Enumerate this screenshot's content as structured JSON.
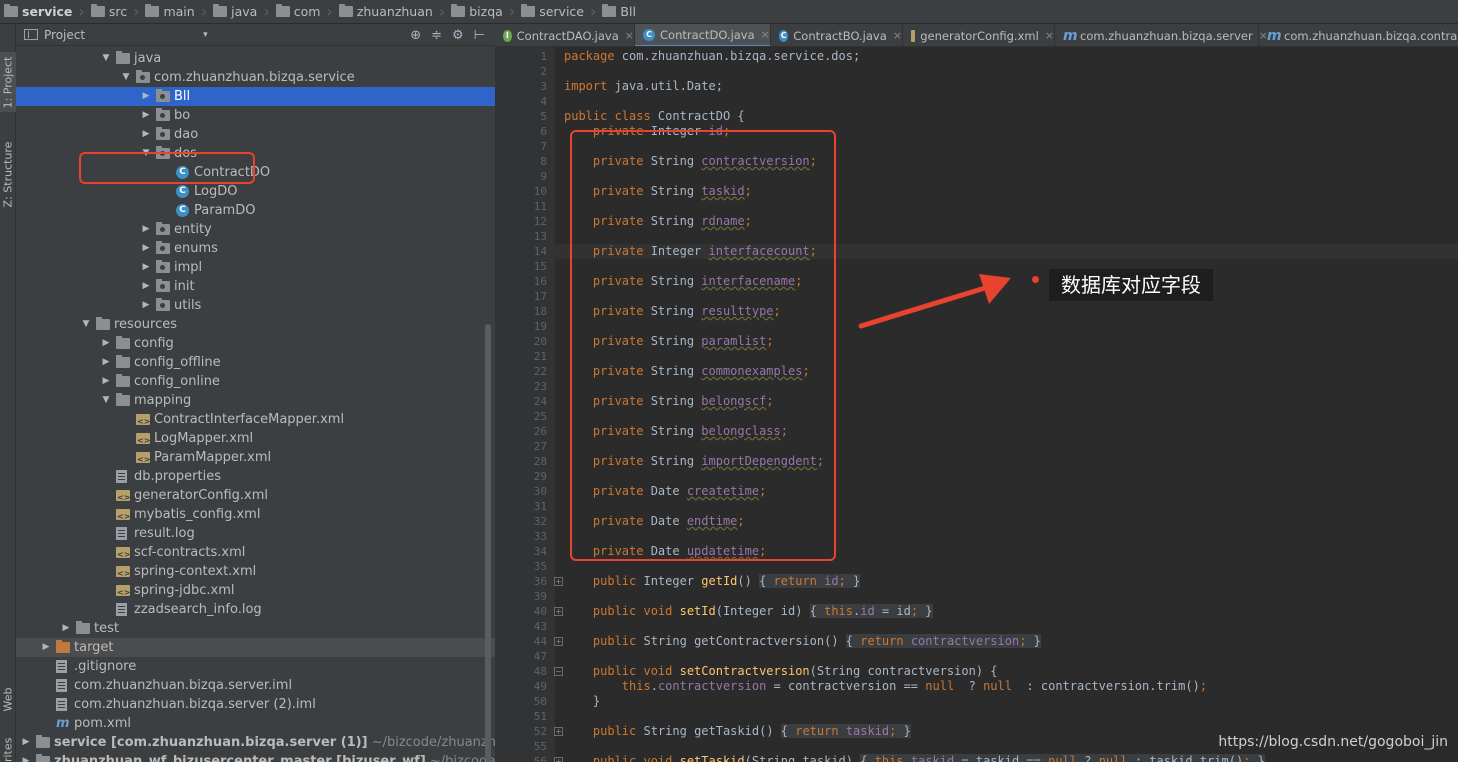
{
  "breadcrumb": [
    "service",
    "src",
    "main",
    "java",
    "com",
    "zhuanzhuan",
    "bizqa",
    "service",
    "Bll"
  ],
  "toolstrip": {
    "project": "1: Project",
    "structure": "Z: Structure",
    "web": "Web",
    "favorites": "Favorites"
  },
  "panel": {
    "title": "Project",
    "dropdown": "▾",
    "icons": [
      "⊕",
      "≑",
      "⚙",
      "⊢"
    ]
  },
  "tree": [
    {
      "label": "java",
      "indent": 4,
      "arrow": "▼",
      "icon": "folder"
    },
    {
      "label": "com.zhuanzhuan.bizqa.service",
      "indent": 5,
      "arrow": "▼",
      "icon": "pkg"
    },
    {
      "label": "Bll",
      "indent": 6,
      "arrow": "▶",
      "icon": "pkg",
      "selected": true
    },
    {
      "label": "bo",
      "indent": 6,
      "arrow": "▶",
      "icon": "pkg"
    },
    {
      "label": "dao",
      "indent": 6,
      "arrow": "▶",
      "icon": "pkg"
    },
    {
      "label": "dos",
      "indent": 6,
      "arrow": "▼",
      "icon": "pkg"
    },
    {
      "label": "ContractDO",
      "indent": 7,
      "arrow": "",
      "icon": "cls"
    },
    {
      "label": "LogDO",
      "indent": 7,
      "arrow": "",
      "icon": "cls"
    },
    {
      "label": "ParamDO",
      "indent": 7,
      "arrow": "",
      "icon": "cls"
    },
    {
      "label": "entity",
      "indent": 6,
      "arrow": "▶",
      "icon": "pkg"
    },
    {
      "label": "enums",
      "indent": 6,
      "arrow": "▶",
      "icon": "pkg"
    },
    {
      "label": "impl",
      "indent": 6,
      "arrow": "▶",
      "icon": "pkg"
    },
    {
      "label": "init",
      "indent": 6,
      "arrow": "▶",
      "icon": "pkg"
    },
    {
      "label": "utils",
      "indent": 6,
      "arrow": "▶",
      "icon": "pkg"
    },
    {
      "label": "resources",
      "indent": 3,
      "arrow": "▼",
      "icon": "folder"
    },
    {
      "label": "config",
      "indent": 4,
      "arrow": "▶",
      "icon": "folder"
    },
    {
      "label": "config_offline",
      "indent": 4,
      "arrow": "▶",
      "icon": "folder"
    },
    {
      "label": "config_online",
      "indent": 4,
      "arrow": "▶",
      "icon": "folder"
    },
    {
      "label": "mapping",
      "indent": 4,
      "arrow": "▼",
      "icon": "folder"
    },
    {
      "label": "ContractInterfaceMapper.xml",
      "indent": 5,
      "arrow": "",
      "icon": "xml"
    },
    {
      "label": "LogMapper.xml",
      "indent": 5,
      "arrow": "",
      "icon": "xml"
    },
    {
      "label": "ParamMapper.xml",
      "indent": 5,
      "arrow": "",
      "icon": "xml"
    },
    {
      "label": "db.properties",
      "indent": 4,
      "arrow": "",
      "icon": "file"
    },
    {
      "label": "generatorConfig.xml",
      "indent": 4,
      "arrow": "",
      "icon": "xml"
    },
    {
      "label": "mybatis_config.xml",
      "indent": 4,
      "arrow": "",
      "icon": "xml"
    },
    {
      "label": "result.log",
      "indent": 4,
      "arrow": "",
      "icon": "file"
    },
    {
      "label": "scf-contracts.xml",
      "indent": 4,
      "arrow": "",
      "icon": "xml"
    },
    {
      "label": "spring-context.xml",
      "indent": 4,
      "arrow": "",
      "icon": "xml"
    },
    {
      "label": "spring-jdbc.xml",
      "indent": 4,
      "arrow": "",
      "icon": "xml"
    },
    {
      "label": "zzadsearch_info.log",
      "indent": 4,
      "arrow": "",
      "icon": "file"
    },
    {
      "label": "test",
      "indent": 2,
      "arrow": "▶",
      "icon": "folder"
    },
    {
      "label": "target",
      "indent": 1,
      "arrow": "▶",
      "icon": "folder-orange",
      "darker": true
    },
    {
      "label": ".gitignore",
      "indent": 1,
      "arrow": "",
      "icon": "file"
    },
    {
      "label": "com.zhuanzhuan.bizqa.server.iml",
      "indent": 1,
      "arrow": "",
      "icon": "file"
    },
    {
      "label": "com.zhuanzhuan.bizqa.server (2).iml",
      "indent": 1,
      "arrow": "",
      "icon": "file"
    },
    {
      "label": "pom.xml",
      "indent": 1,
      "arrow": "",
      "icon": "mvn"
    },
    {
      "label": "service [com.zhuanzhuan.bizqa.server (1)]",
      "muted": " ~/bizcode/zhuanzhuan_scf_bi",
      "indent": 0,
      "arrow": "▶",
      "icon": "folder"
    },
    {
      "label": "zhuanzhuan_wf_bizusercenter_master [bizuser_wf]",
      "muted": " ~/bizcode/zhuanzhu",
      "indent": 0,
      "arrow": "▶",
      "icon": "folder"
    }
  ],
  "tabs": [
    {
      "label": "ContractDAO.java",
      "icon": "i",
      "glyph": "I"
    },
    {
      "label": "ContractDO.java",
      "icon": "c",
      "glyph": "C",
      "active": true
    },
    {
      "label": "ContractBO.java",
      "icon": "c",
      "glyph": "C"
    },
    {
      "label": "generatorConfig.xml",
      "icon": "x",
      "glyph": ""
    },
    {
      "label": "com.zhuanzhuan.bizqa.server",
      "icon": "m",
      "glyph": "m"
    },
    {
      "label": "com.zhuanzhuan.bizqa.contract",
      "icon": "m",
      "glyph": "m"
    }
  ],
  "close_glyph": "×",
  "code": [
    {
      "ln": "1",
      "parts": [
        [
          "kw",
          "package "
        ],
        [
          "",
          "com.zhuanzhuan.bizqa.service.dos;"
        ]
      ]
    },
    {
      "ln": "2",
      "parts": []
    },
    {
      "ln": "3",
      "parts": [
        [
          "kw",
          "import "
        ],
        [
          "",
          "java.util.Date;"
        ]
      ]
    },
    {
      "ln": "4",
      "parts": []
    },
    {
      "ln": "5",
      "parts": [
        [
          "kw",
          "public class "
        ],
        [
          "",
          "ContractDO {"
        ]
      ]
    },
    {
      "ln": "6",
      "parts": [
        [
          "",
          "    "
        ],
        [
          "kw",
          "private "
        ],
        [
          "",
          "Integer "
        ],
        [
          "fldp",
          "id"
        ],
        [
          "kw",
          ";"
        ]
      ]
    },
    {
      "ln": "7",
      "parts": []
    },
    {
      "ln": "8",
      "parts": [
        [
          "",
          "    "
        ],
        [
          "kw",
          "private "
        ],
        [
          "",
          "String "
        ],
        [
          "fld",
          "contractversion"
        ],
        [
          "kw",
          ";"
        ]
      ]
    },
    {
      "ln": "9",
      "parts": []
    },
    {
      "ln": "10",
      "parts": [
        [
          "",
          "    "
        ],
        [
          "kw",
          "private "
        ],
        [
          "",
          "String "
        ],
        [
          "fld",
          "taskid"
        ],
        [
          "kw",
          ";"
        ]
      ]
    },
    {
      "ln": "11",
      "parts": []
    },
    {
      "ln": "12",
      "parts": [
        [
          "",
          "    "
        ],
        [
          "kw",
          "private "
        ],
        [
          "",
          "String "
        ],
        [
          "fld",
          "rdname"
        ],
        [
          "kw",
          ";"
        ]
      ]
    },
    {
      "ln": "13",
      "parts": []
    },
    {
      "ln": "14",
      "parts": [
        [
          "",
          "    "
        ],
        [
          "kw",
          "private "
        ],
        [
          "",
          "Integer "
        ],
        [
          "fld",
          "interfacecount"
        ],
        [
          "kw",
          ";"
        ]
      ]
    },
    {
      "ln": "15",
      "parts": []
    },
    {
      "ln": "16",
      "parts": [
        [
          "",
          "    "
        ],
        [
          "kw",
          "private "
        ],
        [
          "",
          "String "
        ],
        [
          "fld",
          "interfacename"
        ],
        [
          "kw",
          ";"
        ]
      ]
    },
    {
      "ln": "17",
      "parts": []
    },
    {
      "ln": "18",
      "parts": [
        [
          "",
          "    "
        ],
        [
          "kw",
          "private "
        ],
        [
          "",
          "String "
        ],
        [
          "fld",
          "resulttype"
        ],
        [
          "kw",
          ";"
        ]
      ]
    },
    {
      "ln": "19",
      "parts": []
    },
    {
      "ln": "20",
      "parts": [
        [
          "",
          "    "
        ],
        [
          "kw",
          "private "
        ],
        [
          "",
          "String "
        ],
        [
          "fld",
          "paramlist"
        ],
        [
          "kw",
          ";"
        ]
      ]
    },
    {
      "ln": "21",
      "parts": []
    },
    {
      "ln": "22",
      "parts": [
        [
          "",
          "    "
        ],
        [
          "kw",
          "private "
        ],
        [
          "",
          "String "
        ],
        [
          "fld",
          "commonexamples"
        ],
        [
          "kw",
          ";"
        ]
      ]
    },
    {
      "ln": "23",
      "parts": []
    },
    {
      "ln": "24",
      "parts": [
        [
          "",
          "    "
        ],
        [
          "kw",
          "private "
        ],
        [
          "",
          "String "
        ],
        [
          "fld",
          "belongscf"
        ],
        [
          "kw",
          ";"
        ]
      ]
    },
    {
      "ln": "25",
      "parts": []
    },
    {
      "ln": "26",
      "parts": [
        [
          "",
          "    "
        ],
        [
          "kw",
          "private "
        ],
        [
          "",
          "String "
        ],
        [
          "fld",
          "belongclass"
        ],
        [
          "kw",
          ";"
        ]
      ]
    },
    {
      "ln": "27",
      "parts": []
    },
    {
      "ln": "28",
      "parts": [
        [
          "",
          "    "
        ],
        [
          "kw",
          "private "
        ],
        [
          "",
          "String "
        ],
        [
          "fld",
          "importDepengdent"
        ],
        [
          "kw",
          ";"
        ]
      ]
    },
    {
      "ln": "29",
      "parts": []
    },
    {
      "ln": "30",
      "parts": [
        [
          "",
          "    "
        ],
        [
          "kw",
          "private "
        ],
        [
          "",
          "Date "
        ],
        [
          "fld",
          "createtime"
        ],
        [
          "kw",
          ";"
        ]
      ]
    },
    {
      "ln": "31",
      "parts": []
    },
    {
      "ln": "32",
      "parts": [
        [
          "",
          "    "
        ],
        [
          "kw",
          "private "
        ],
        [
          "",
          "Date "
        ],
        [
          "fld",
          "endtime"
        ],
        [
          "kw",
          ";"
        ]
      ]
    },
    {
      "ln": "33",
      "parts": []
    },
    {
      "ln": "34",
      "parts": [
        [
          "",
          "    "
        ],
        [
          "kw",
          "private "
        ],
        [
          "",
          "Date "
        ],
        [
          "fld",
          "updatetime"
        ],
        [
          "kw",
          ";"
        ]
      ]
    },
    {
      "ln": "35",
      "parts": []
    },
    {
      "ln": "36",
      "fold": "+",
      "parts": [
        [
          "",
          "    "
        ],
        [
          "kw",
          "public "
        ],
        [
          "",
          "Integer "
        ],
        [
          "meth",
          "getId"
        ],
        [
          "",
          "() "
        ],
        [
          "fb",
          "{ "
        ],
        [
          "kw fb",
          "return "
        ],
        [
          "fldp fb",
          "id"
        ],
        [
          "kw fb",
          ";"
        ],
        [
          "fb",
          " }"
        ]
      ]
    },
    {
      "ln": "39",
      "parts": []
    },
    {
      "ln": "40",
      "fold": "+",
      "parts": [
        [
          "",
          "    "
        ],
        [
          "kw",
          "public void "
        ],
        [
          "meth",
          "setId"
        ],
        [
          "",
          "(Integer id) "
        ],
        [
          "fb",
          "{ "
        ],
        [
          "kw fb",
          "this"
        ],
        [
          "fb",
          "."
        ],
        [
          "fldp fb",
          "id"
        ],
        [
          "fb",
          " = id"
        ],
        [
          "kw fb",
          ";"
        ],
        [
          "fb",
          " }"
        ]
      ]
    },
    {
      "ln": "43",
      "parts": []
    },
    {
      "ln": "44",
      "fold": "+",
      "parts": [
        [
          "",
          "    "
        ],
        [
          "kw",
          "public "
        ],
        [
          "",
          "String "
        ],
        [
          "methg",
          "getContractversion"
        ],
        [
          "",
          "() "
        ],
        [
          "fb",
          "{ "
        ],
        [
          "kw fb",
          "return "
        ],
        [
          "fldp fb",
          "contractversion"
        ],
        [
          "kw fb",
          ";"
        ],
        [
          "fb",
          " }"
        ]
      ]
    },
    {
      "ln": "47",
      "parts": []
    },
    {
      "ln": "48",
      "fold": "-",
      "parts": [
        [
          "",
          "    "
        ],
        [
          "kw",
          "public void "
        ],
        [
          "meth",
          "setContractversion"
        ],
        [
          "",
          "(String contractversion) {"
        ]
      ]
    },
    {
      "ln": "49",
      "parts": [
        [
          "",
          "        "
        ],
        [
          "kw",
          "this"
        ],
        [
          "",
          "."
        ],
        [
          "fldp",
          "contractversion"
        ],
        [
          "",
          " = contractversion == "
        ],
        [
          "kw",
          "null "
        ],
        [
          "",
          " ? "
        ],
        [
          "kw",
          "null "
        ],
        [
          "",
          " : contractversion.trim()"
        ],
        [
          "kw",
          ";"
        ]
      ]
    },
    {
      "ln": "50",
      "parts": [
        [
          "",
          "    }"
        ]
      ]
    },
    {
      "ln": "51",
      "parts": []
    },
    {
      "ln": "52",
      "fold": "+",
      "parts": [
        [
          "",
          "    "
        ],
        [
          "kw",
          "public "
        ],
        [
          "",
          "String "
        ],
        [
          "methg",
          "getTaskid"
        ],
        [
          "",
          "() "
        ],
        [
          "fb",
          "{ "
        ],
        [
          "kw fb",
          "return "
        ],
        [
          "fldp fb",
          "taskid"
        ],
        [
          "kw fb",
          ";"
        ],
        [
          "fb",
          " }"
        ]
      ]
    },
    {
      "ln": "55",
      "parts": []
    },
    {
      "ln": "56",
      "fold": "+",
      "parts": [
        [
          "",
          "    "
        ],
        [
          "kw",
          "public void "
        ],
        [
          "meth",
          "setTaskid"
        ],
        [
          "",
          "(String taskid) "
        ],
        [
          "fb",
          "{ "
        ],
        [
          "kw fb",
          "this"
        ],
        [
          "fb",
          "."
        ],
        [
          "fldp fb",
          "taskid"
        ],
        [
          "fb",
          " = taskid == "
        ],
        [
          "kw fb",
          "null "
        ],
        [
          "fb",
          "? "
        ],
        [
          "kw fb",
          "null "
        ],
        [
          "fb",
          ": taskid.trim()"
        ],
        [
          "kw fb",
          ";"
        ],
        [
          "fb",
          " }"
        ]
      ]
    }
  ],
  "annotation": {
    "callout": "数据库对应字段",
    "color": "#e8432e"
  },
  "watermark": "https://blog.csdn.net/gogoboi_jin",
  "colors": {
    "keyword": "#cc7832",
    "field": "#9876aa",
    "method": "#ffc66d",
    "selection": "#2f65ca"
  }
}
